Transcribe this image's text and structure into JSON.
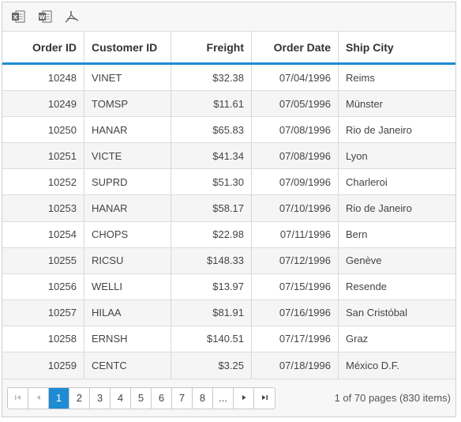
{
  "toolbar": {
    "items": [
      {
        "icon": "excel-export-icon"
      },
      {
        "icon": "word-export-icon"
      },
      {
        "icon": "pdf-export-icon"
      }
    ]
  },
  "columns": [
    {
      "label": "Order ID",
      "align": "right"
    },
    {
      "label": "Customer ID",
      "align": "left"
    },
    {
      "label": "Freight",
      "align": "right"
    },
    {
      "label": "Order Date",
      "align": "right"
    },
    {
      "label": "Ship City",
      "align": "left"
    }
  ],
  "rows": [
    [
      "10248",
      "VINET",
      "$32.38",
      "07/04/1996",
      "Reims"
    ],
    [
      "10249",
      "TOMSP",
      "$11.61",
      "07/05/1996",
      "Münster"
    ],
    [
      "10250",
      "HANAR",
      "$65.83",
      "07/08/1996",
      "Rio de Janeiro"
    ],
    [
      "10251",
      "VICTE",
      "$41.34",
      "07/08/1996",
      "Lyon"
    ],
    [
      "10252",
      "SUPRD",
      "$51.30",
      "07/09/1996",
      "Charleroi"
    ],
    [
      "10253",
      "HANAR",
      "$58.17",
      "07/10/1996",
      "Rio de Janeiro"
    ],
    [
      "10254",
      "CHOPS",
      "$22.98",
      "07/11/1996",
      "Bern"
    ],
    [
      "10255",
      "RICSU",
      "$148.33",
      "07/12/1996",
      "Genève"
    ],
    [
      "10256",
      "WELLI",
      "$13.97",
      "07/15/1996",
      "Resende"
    ],
    [
      "10257",
      "HILAA",
      "$81.91",
      "07/16/1996",
      "San Cristóbal"
    ],
    [
      "10258",
      "ERNSH",
      "$140.51",
      "07/17/1996",
      "Graz"
    ],
    [
      "10259",
      "CENTC",
      "$3.25",
      "07/18/1996",
      "México D.F."
    ]
  ],
  "pager": {
    "first": "⏮",
    "prev": "◀",
    "pages": [
      "1",
      "2",
      "3",
      "4",
      "5",
      "6",
      "7",
      "8",
      "..."
    ],
    "current": "1",
    "next": "▶",
    "last": "⏭",
    "info": "1 of 70 pages (830 items)"
  },
  "colors": {
    "accent": "#1e8bd3"
  }
}
